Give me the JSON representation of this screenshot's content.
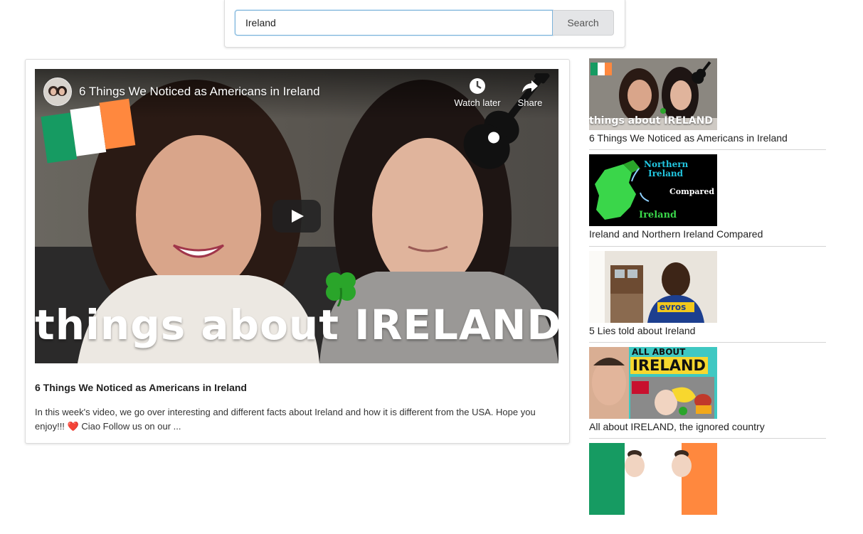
{
  "search": {
    "value": "Ireland",
    "button_label": "Search"
  },
  "main_video": {
    "player_title": "6 Things We Noticed as Americans in Ireland",
    "watch_later_label": "Watch later",
    "share_label": "Share",
    "overlay_text": "things about IRELAND",
    "title": "6 Things We Noticed as Americans in Ireland",
    "description": "In this week's video, we go over interesting and different facts about Ireland and how it is different from the USA. Hope you enjoy!!! ❤️ Ciao Follow us on our ..."
  },
  "sidebar": {
    "items": [
      {
        "title": "6 Things We Noticed as Americans in Ireland",
        "thumb_text": "things about IRELAND"
      },
      {
        "title": "Ireland and Northern Ireland Compared",
        "thumb_text_1": "Northern",
        "thumb_text_2": "Ireland",
        "thumb_text_3": "Compared",
        "thumb_text_4": "Ireland"
      },
      {
        "title": "5 Lies told about Ireland",
        "thumb_text": "evros"
      },
      {
        "title": "All about IRELAND, the ignored country",
        "thumb_text_1": "ALL ABOUT",
        "thumb_text_2": "IRELAND"
      },
      {
        "title": ""
      }
    ]
  },
  "colors": {
    "irish_green": "#169b62",
    "irish_orange": "#ff883e",
    "search_border": "#7bb3d9"
  }
}
